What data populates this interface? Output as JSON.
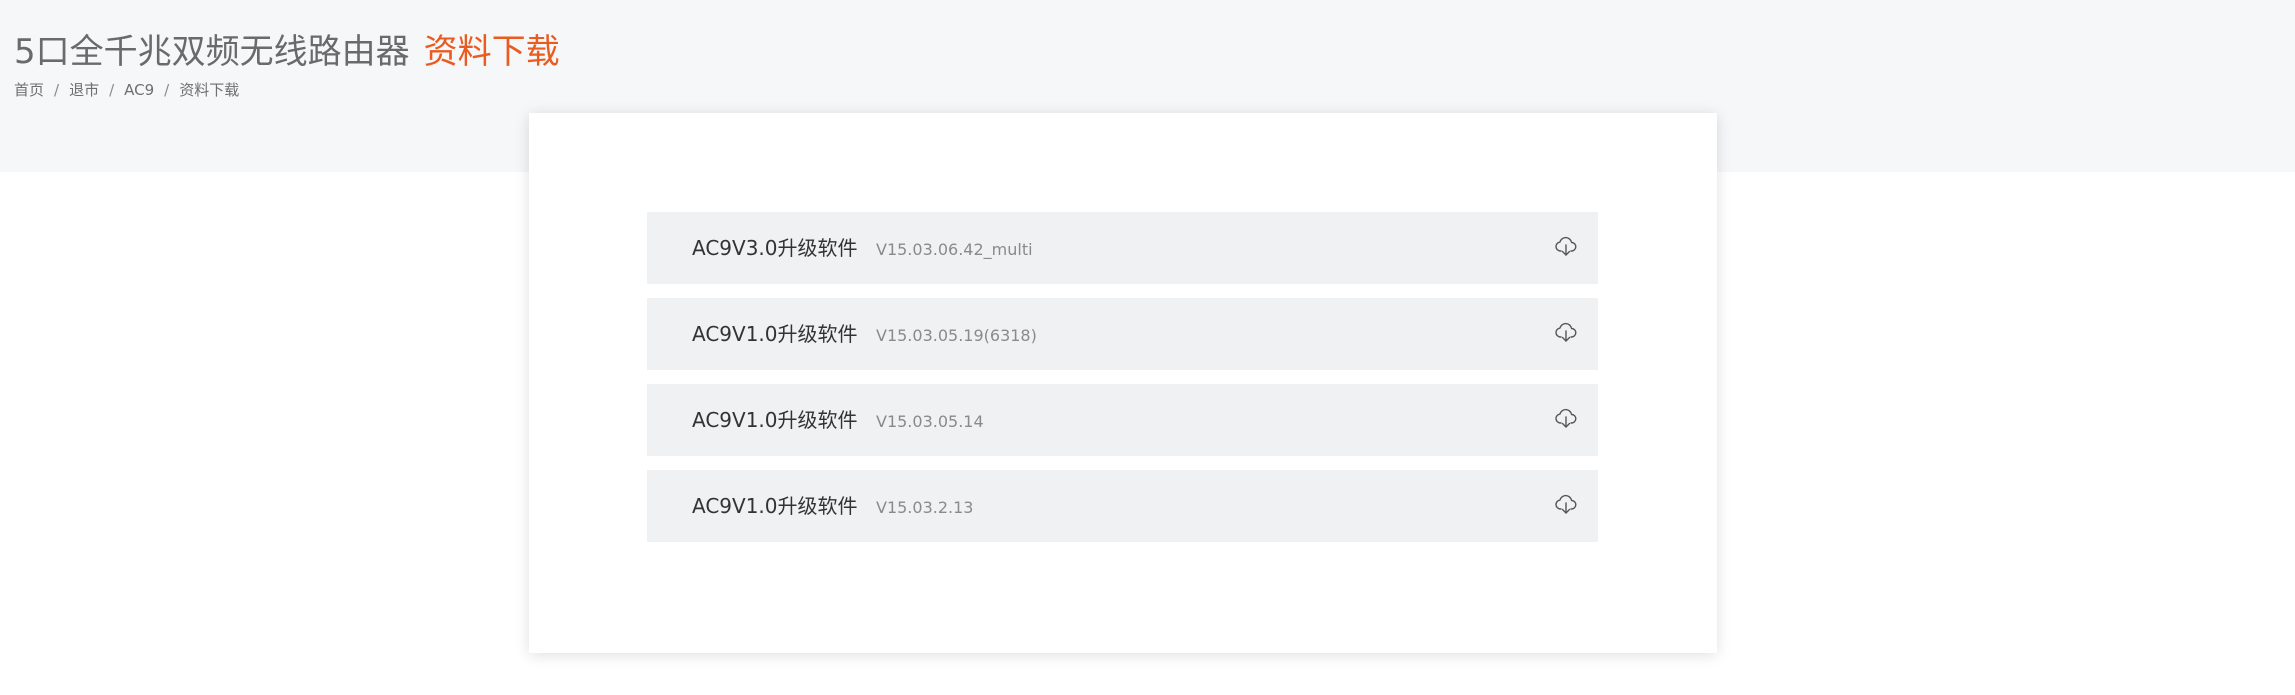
{
  "header": {
    "title": "5口全千兆双频无线路由器",
    "subtitle": "资料下载"
  },
  "breadcrumb": {
    "items": [
      "首页",
      "退市",
      "AC9",
      "资料下载"
    ],
    "separator": "/"
  },
  "downloads": [
    {
      "name": "AC9V3.0升级软件",
      "version": "V15.03.06.42_multi",
      "icon": "cloud-download-icon"
    },
    {
      "name": "AC9V1.0升级软件",
      "version": "V15.03.05.19(6318)",
      "icon": "cloud-download-icon"
    },
    {
      "name": "AC9V1.0升级软件",
      "version": "V15.03.05.14",
      "icon": "cloud-download-icon"
    },
    {
      "name": "AC9V1.0升级软件",
      "version": "V15.03.2.13",
      "icon": "cloud-download-icon"
    }
  ],
  "colors": {
    "header_background": "#f6f7f8",
    "title": "#6a6a6a",
    "subtitle_accent": "#ea5b1f",
    "item_background": "#f0f1f2",
    "item_name": "#333333",
    "item_version": "#8a8a8a"
  }
}
